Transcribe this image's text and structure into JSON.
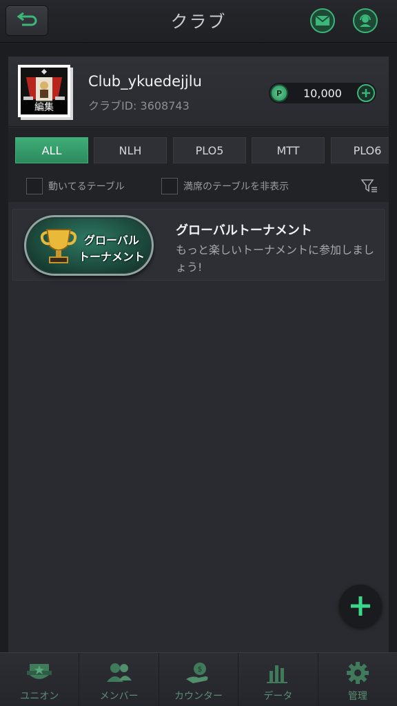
{
  "header": {
    "title": "クラブ",
    "back_icon": "back-arrow-icon",
    "mail_icon": "mail-icon",
    "support_icon": "support-agent-icon"
  },
  "club": {
    "name": "Club_ykuedejjlu",
    "id_text": "クラブID: 3608743",
    "avatar_edit_label": "編集",
    "points": "10,000",
    "points_badge": "P"
  },
  "tabs": [
    {
      "label": "ALL",
      "active": true
    },
    {
      "label": "NLH",
      "active": false
    },
    {
      "label": "PLO5",
      "active": false
    },
    {
      "label": "MTT",
      "active": false
    },
    {
      "label": "PLO6",
      "active": false
    }
  ],
  "filters": {
    "active_tables": "動いてるテーブル",
    "hide_full": "満席のテーブルを非表示"
  },
  "tournament": {
    "badge_line1": "グローバル",
    "badge_line2": "トーナメント",
    "title": "グローバルトーナメント",
    "description": "もっと楽しいトーナメントに参加しましょう!"
  },
  "nav": [
    {
      "label": "ユニオン",
      "icon": "union-shield-icon"
    },
    {
      "label": "メンバー",
      "icon": "members-icon"
    },
    {
      "label": "カウンター",
      "icon": "counter-coin-hand-icon"
    },
    {
      "label": "データ",
      "icon": "bar-chart-icon"
    },
    {
      "label": "管理",
      "icon": "gear-icon"
    }
  ],
  "colors": {
    "accent": "#3bb779",
    "background": "#1c1d21",
    "panel": "#2a2b30"
  }
}
